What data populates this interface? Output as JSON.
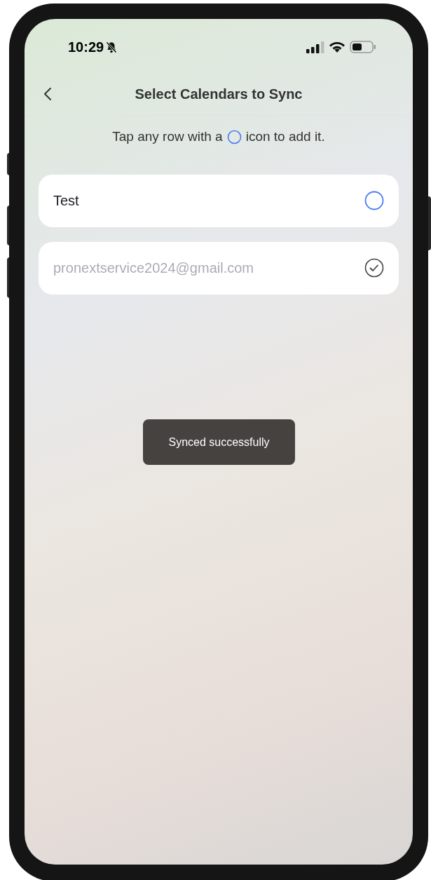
{
  "status_bar": {
    "time": "10:29",
    "silent": true
  },
  "header": {
    "title": "Select Calendars to Sync"
  },
  "hint": {
    "before": "Tap any row with a",
    "after": "icon to add it."
  },
  "calendars": [
    {
      "name": "Test",
      "checked": false
    },
    {
      "name": "pronextservice2024@gmail.com",
      "checked": true
    }
  ],
  "toast": {
    "message": "Synced successfully"
  }
}
